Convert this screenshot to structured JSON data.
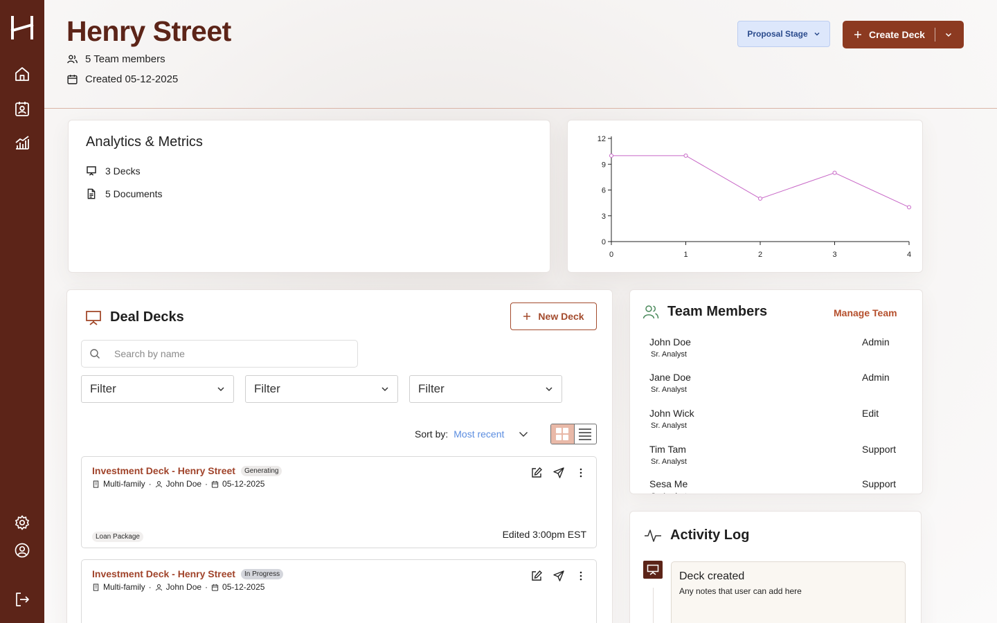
{
  "sidebar": {
    "logo": "logo-h-icon",
    "nav": [
      "home-icon",
      "contacts-icon",
      "analytics-icon"
    ],
    "bottom": [
      "settings-icon",
      "profile-icon",
      "logout-icon"
    ]
  },
  "header": {
    "title": "Henry Street",
    "team_count": "5 Team members",
    "created": "Created 05-12-2025",
    "stage_label": "Proposal Stage",
    "create_label": "Create Deck"
  },
  "analytics": {
    "title": "Analytics & Metrics",
    "decks": "3 Decks",
    "documents": "5 Documents"
  },
  "chart_data": {
    "type": "line",
    "x": [
      0,
      1,
      2,
      3,
      4
    ],
    "y": [
      10,
      10,
      5,
      8,
      4
    ],
    "xticks": [
      "0",
      "1",
      "2",
      "3",
      "4"
    ],
    "yticks": [
      "0",
      "3",
      "6",
      "9",
      "12"
    ],
    "ylim": [
      0,
      12
    ],
    "xlim": [
      0,
      4
    ],
    "color": "#c766c6",
    "title": "",
    "xlabel": "",
    "ylabel": ""
  },
  "decks": {
    "title": "Deal Decks",
    "new_label": "New Deck",
    "search_placeholder": "Search by name",
    "filters": [
      "Filter",
      "Filter",
      "Filter"
    ],
    "sort_label": "Sort by:",
    "sort_value": "Most recent",
    "items": [
      {
        "name": "Investment Deck - Henry Street",
        "status": "Generating",
        "type": "Multi-family",
        "owner": "John Doe",
        "date": "05-12-2025",
        "tag": "Loan Package",
        "edited": "Edited 3:00pm EST"
      },
      {
        "name": "Investment Deck - Henry Street",
        "status": "In Progress",
        "type": "Multi-family",
        "owner": "John Doe",
        "date": "05-12-2025"
      }
    ]
  },
  "team": {
    "title": "Team Members",
    "manage_label": "Manage Team",
    "members": [
      {
        "name": "John Doe",
        "role": "Sr. Analyst",
        "permission": "Admin"
      },
      {
        "name": "Jane Doe",
        "role": "Sr. Analyst",
        "permission": "Admin"
      },
      {
        "name": "John Wick",
        "role": "Sr. Analyst",
        "permission": "Edit"
      },
      {
        "name": "Tim Tam",
        "role": "Sr. Analyst",
        "permission": "Support"
      },
      {
        "name": "Sesa Me",
        "role": "Sr. Analyst",
        "permission": "Support"
      }
    ]
  },
  "activity": {
    "title": "Activity Log",
    "entries": [
      {
        "title": "Deck created",
        "note": "Any notes that user can add here"
      }
    ]
  }
}
